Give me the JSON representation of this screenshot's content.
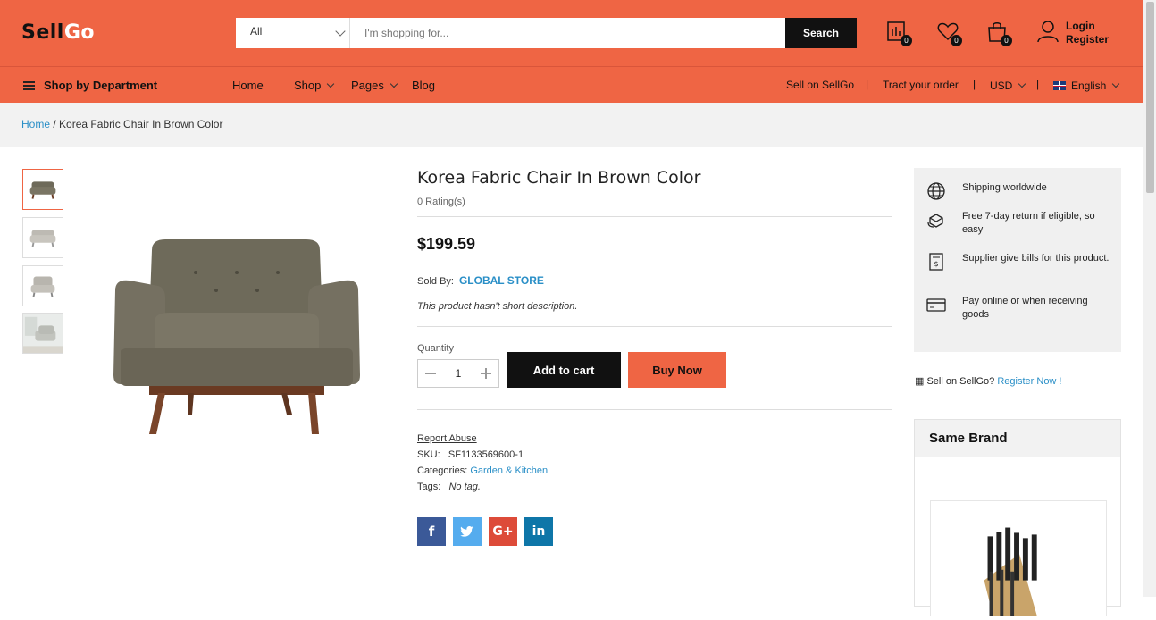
{
  "header": {
    "logo_part1": "Sell",
    "logo_part2": "Go",
    "search_category": "All",
    "search_placeholder": "I'm shopping for...",
    "search_button": "Search",
    "compare_count": "0",
    "wishlist_count": "0",
    "cart_count": "0",
    "login": "Login",
    "register": "Register"
  },
  "nav": {
    "department": "Shop by Department",
    "items": [
      "Home",
      "Shop",
      "Pages",
      "Blog"
    ],
    "sell": "Sell on SellGo",
    "track": "Tract your order",
    "currency": "USD",
    "language": "English"
  },
  "breadcrumb": {
    "home": "Home",
    "separator": " / ",
    "current": "Korea Fabric Chair In Brown Color"
  },
  "product": {
    "title": "Korea Fabric Chair In Brown Color",
    "rating": "0 Rating(s)",
    "price": "$199.59",
    "sold_by_label": "Sold By:",
    "store": "GLOBAL STORE",
    "short_description": "This product hasn't short description.",
    "quantity_label": "Quantity",
    "quantity": "1",
    "add_to_cart": "Add to cart",
    "buy_now": "Buy Now",
    "report": "Report Abuse",
    "sku_label": "SKU:",
    "sku": "SF1133569600-1",
    "categories_label": "Categories:",
    "category": "Garden & Kitchen",
    "tags_label": "Tags:",
    "tags": "No tag.",
    "chair_color": "#6e6a5a"
  },
  "social": {
    "facebook": "f",
    "twitter": "t",
    "googleplus": "G+",
    "linkedin": "in"
  },
  "sidebar": {
    "features": [
      "Shipping worldwide",
      "Free 7-day return if eligible, so easy",
      "Supplier give bills for this product.",
      "Pay online or when receiving goods"
    ],
    "sell_prefix": "Sell on SellGo?",
    "register_now": "Register Now !",
    "same_brand": "Same Brand"
  },
  "colors": {
    "accent": "#ef6544",
    "link": "#2a8fc7",
    "dark": "#111111"
  }
}
